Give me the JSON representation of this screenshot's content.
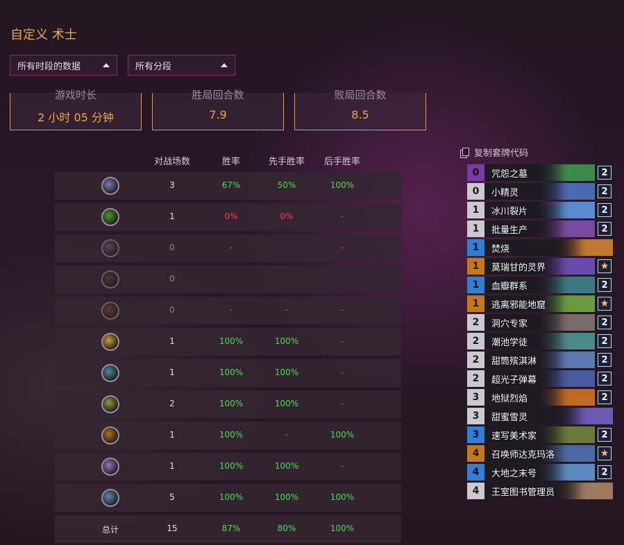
{
  "page": {
    "title": "自定义 术士"
  },
  "filters": {
    "time": "所有时段的数据",
    "rank": "所有分段"
  },
  "stats": [
    {
      "label": "游戏时长",
      "value": "2 小时 05 分钟"
    },
    {
      "label": "胜局回合数",
      "value": "7.9"
    },
    {
      "label": "败局回合数",
      "value": "8.5"
    }
  ],
  "table": {
    "headers": {
      "games": "对战场数",
      "winrate": "胜率",
      "first": "先手胜率",
      "second": "后手胜率"
    },
    "rows": [
      {
        "icon": "class-icon-1",
        "color": "#6f7fb0",
        "games": "3",
        "winrate": "67%",
        "first": "50%",
        "second": "100%"
      },
      {
        "icon": "class-icon-2",
        "color": "#4a9a2a",
        "games": "1",
        "winrate": "0%",
        "first": "0%",
        "second": "-"
      },
      {
        "icon": "class-icon-3",
        "color": "#6a6478",
        "games": "0",
        "winrate": "-",
        "first": "",
        "second": "-"
      },
      {
        "icon": "class-icon-4",
        "color": "#6a4030",
        "games": "0",
        "winrate": "",
        "first": "",
        "second": ""
      },
      {
        "icon": "class-icon-5",
        "color": "#8a4a2a",
        "games": "0",
        "winrate": "-",
        "first": "-",
        "second": "-"
      },
      {
        "icon": "class-icon-6",
        "color": "#c8a030",
        "games": "1",
        "winrate": "100%",
        "first": "100%",
        "second": "-"
      },
      {
        "icon": "class-icon-7",
        "color": "#4a8a9a",
        "games": "1",
        "winrate": "100%",
        "first": "100%",
        "second": "-"
      },
      {
        "icon": "class-icon-8",
        "color": "#8a9a40",
        "games": "2",
        "winrate": "100%",
        "first": "100%",
        "second": "-"
      },
      {
        "icon": "class-icon-9",
        "color": "#b07020",
        "games": "1",
        "winrate": "100%",
        "first": "-",
        "second": "100%"
      },
      {
        "icon": "class-icon-10",
        "color": "#9a70c0",
        "games": "1",
        "winrate": "100%",
        "first": "100%",
        "second": "-"
      },
      {
        "icon": "class-icon-11",
        "color": "#5a8ab0",
        "games": "5",
        "winrate": "100%",
        "first": "100%",
        "second": "100%"
      }
    ],
    "total": {
      "label": "总计",
      "games": "15",
      "winrate": "87%",
      "first": "80%",
      "second": "100%"
    }
  },
  "deck": {
    "copy_label": "复制套牌代码",
    "cards": [
      {
        "cost": "0",
        "name": "咒怨之墓",
        "count": "2",
        "rarity": "epic",
        "art": "#3c8a4a"
      },
      {
        "cost": "0",
        "name": "小精灵",
        "count": "2",
        "rarity": "common",
        "art": "#4a6ab0"
      },
      {
        "cost": "1",
        "name": "冰川裂片",
        "count": "2",
        "rarity": "common",
        "art": "#5a8ad0"
      },
      {
        "cost": "1",
        "name": "批量生产",
        "count": "2",
        "rarity": "common",
        "art": "#7a4aa0"
      },
      {
        "cost": "1",
        "name": "焚烧",
        "count": "",
        "rarity": "rare",
        "art": "#c07830"
      },
      {
        "cost": "1",
        "name": "莫瑞甘的灵界",
        "count": "★",
        "rarity": "legendary",
        "art": "#6a4ab0"
      },
      {
        "cost": "1",
        "name": "血瓣群系",
        "count": "2",
        "rarity": "rare",
        "art": "#3a7a80"
      },
      {
        "cost": "1",
        "name": "逃离邪能地窟",
        "count": "★",
        "rarity": "legendary",
        "art": "#6a9a40"
      },
      {
        "cost": "2",
        "name": "洞穴专家",
        "count": "2",
        "rarity": "common",
        "art": "#7a6a6a"
      },
      {
        "cost": "2",
        "name": "潮池学徒",
        "count": "2",
        "rarity": "common",
        "art": "#4a8a8a"
      },
      {
        "cost": "2",
        "name": "甜筒殡淇淋",
        "count": "2",
        "rarity": "common",
        "art": "#5a7ab0"
      },
      {
        "cost": "2",
        "name": "超光子弹幕",
        "count": "2",
        "rarity": "common",
        "art": "#4a5aa0"
      },
      {
        "cost": "3",
        "name": "地狱烈焰",
        "count": "2",
        "rarity": "common",
        "art": "#c06a20"
      },
      {
        "cost": "3",
        "name": "甜蜜雪灵",
        "count": "",
        "rarity": "common",
        "art": "#6a5ab0"
      },
      {
        "cost": "3",
        "name": "速写美术家",
        "count": "2",
        "rarity": "rare",
        "art": "#6a7a3a"
      },
      {
        "cost": "4",
        "name": "召唤师达克玛洛",
        "count": "★",
        "rarity": "legendary",
        "art": "#4a6aa0"
      },
      {
        "cost": "4",
        "name": "大地之末号",
        "count": "2",
        "rarity": "rare",
        "art": "#5a8ac0"
      },
      {
        "cost": "4",
        "name": "王室图书管理员",
        "count": "",
        "rarity": "common",
        "art": "#a07a60"
      }
    ]
  }
}
